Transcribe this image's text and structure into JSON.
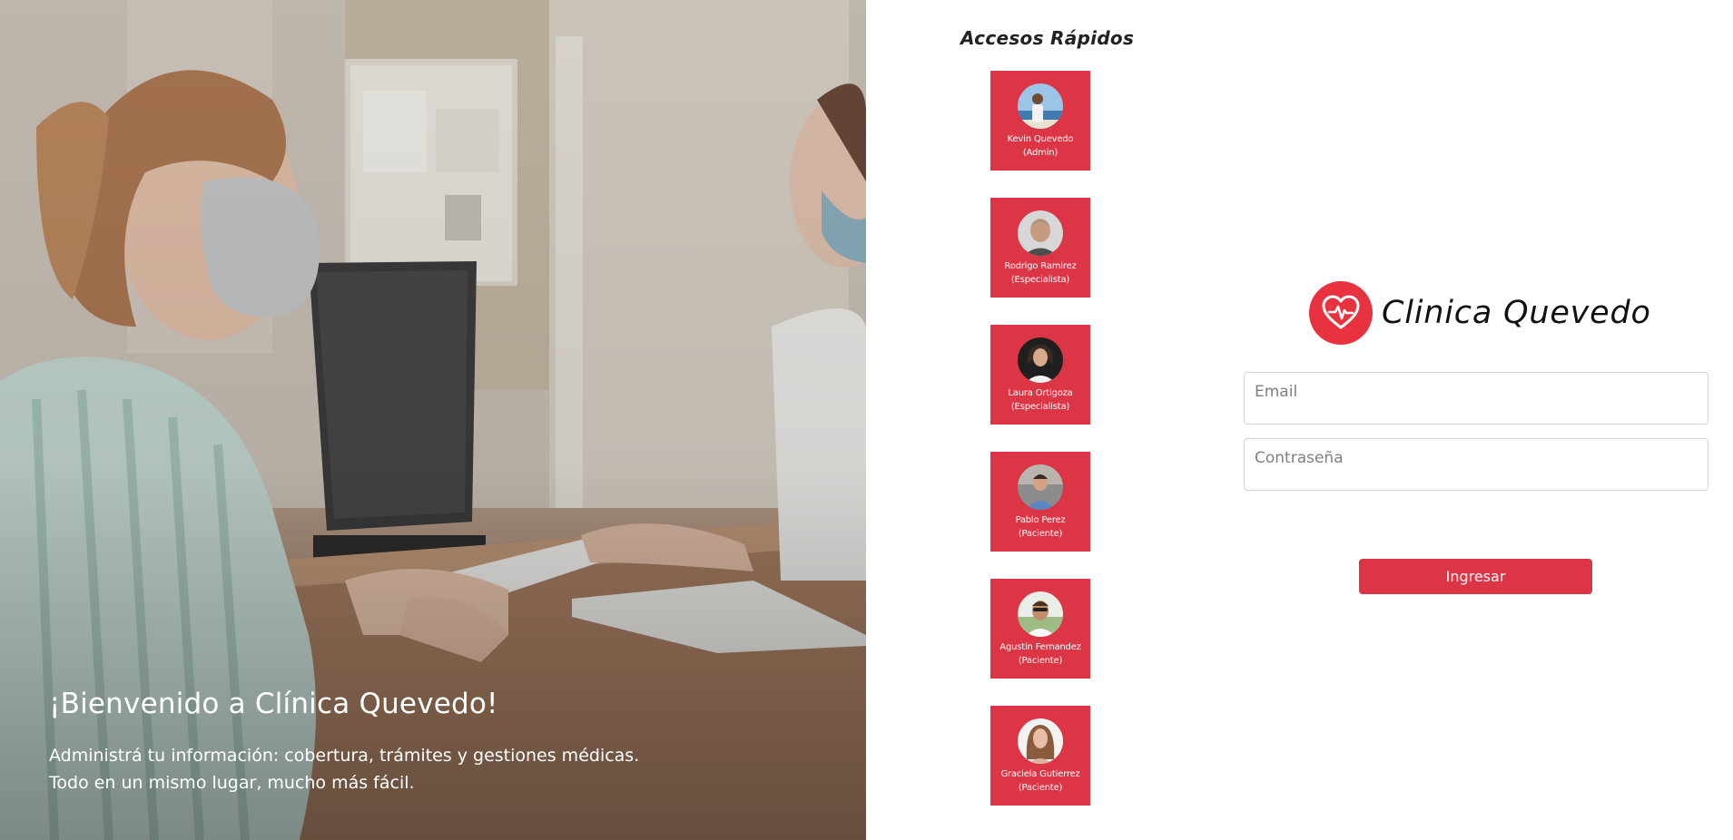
{
  "hero": {
    "title": "¡Bienvenido a Clínica Quevedo!",
    "subtitle_line1": "Administrá tu información: cobertura, trámites y gestiones médicas.",
    "subtitle_line2": "Todo en un mismo lugar, mucho más fácil."
  },
  "quick_access": {
    "title": "Accesos Rápidos",
    "users": [
      {
        "name": "Kevin Quevedo",
        "role": "(Admin)"
      },
      {
        "name": "Rodrigo Ramirez",
        "role": "(Especialista)"
      },
      {
        "name": "Laura Ortigoza",
        "role": "(Especialista)"
      },
      {
        "name": "Pablo Perez",
        "role": "(Paciente)"
      },
      {
        "name": "Agustin Fernandez",
        "role": "(Paciente)"
      },
      {
        "name": "Graciela Gutierrez",
        "role": "(Paciente)"
      }
    ]
  },
  "brand": {
    "name": "Clinica Quevedo",
    "icon": "heart-pulse-icon"
  },
  "login": {
    "email_placeholder": "Email",
    "email_value": "",
    "password_placeholder": "Contraseña",
    "password_value": "",
    "submit_label": "Ingresar"
  },
  "colors": {
    "accent": "#dc3545",
    "logo": "#e8323f",
    "text": "#222222",
    "input_border": "#d4d4d4"
  }
}
